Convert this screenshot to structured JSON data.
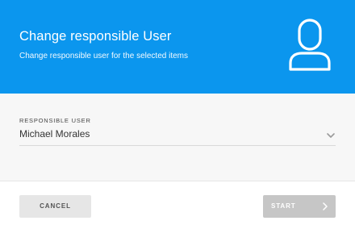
{
  "header": {
    "title": "Change responsible User",
    "subtitle": "Change responsible user for the selected items",
    "icon": "user-icon",
    "background_color": "#0b96ee"
  },
  "form": {
    "field_label": "RESPONSIBLE USER",
    "selected_value": "Michael Morales",
    "dropdown_icon": "chevron-down-icon"
  },
  "footer": {
    "cancel_label": "CANCEL",
    "start_label": "START",
    "start_icon": "chevron-right-icon",
    "start_disabled": true
  }
}
